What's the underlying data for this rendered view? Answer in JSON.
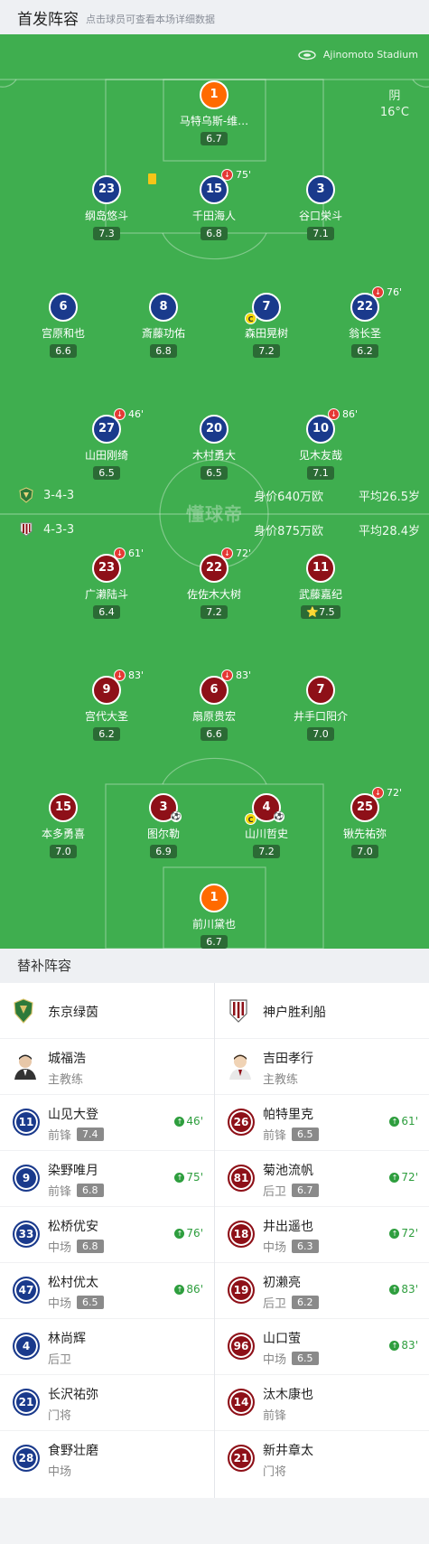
{
  "header": {
    "title": "首发阵容",
    "subtitle": "点击球员可查看本场详细数据"
  },
  "match": {
    "stadium": "Ajinomoto Stadium",
    "weather": "阴",
    "temperature": "16°C",
    "watermark": "懂球帝"
  },
  "colors": {
    "home": "#1a3a8c",
    "away": "#8e1018",
    "goalkeeper": "#ff6a00",
    "pitch": "#3fae4f"
  },
  "home_team": {
    "formation": "3-4-3",
    "value": "身价640万欧",
    "avg_age": "平均26.5岁"
  },
  "away_team": {
    "formation": "4-3-3",
    "value": "身价875万欧",
    "avg_age": "平均28.4岁"
  },
  "home_players": [
    {
      "number": "1",
      "name": "马特乌斯-维…",
      "rating": "6.7"
    },
    {
      "number": "23",
      "name": "纲岛悠斗",
      "rating": "7.3",
      "yellow_card": true
    },
    {
      "number": "15",
      "name": "千田海人",
      "rating": "6.8",
      "sub_minute": "75'"
    },
    {
      "number": "3",
      "name": "谷口栄斗",
      "rating": "7.1"
    },
    {
      "number": "6",
      "name": "宫原和也",
      "rating": "6.6"
    },
    {
      "number": "8",
      "name": "斎藤功佑",
      "rating": "6.8"
    },
    {
      "number": "7",
      "name": "森田晃树",
      "rating": "7.2",
      "captain": true
    },
    {
      "number": "22",
      "name": "翁长圣",
      "rating": "6.2",
      "sub_minute": "76'"
    },
    {
      "number": "27",
      "name": "山田刚绮",
      "rating": "6.5",
      "sub_minute": "46'"
    },
    {
      "number": "20",
      "name": "木村勇大",
      "rating": "6.5"
    },
    {
      "number": "10",
      "name": "见木友哉",
      "rating": "7.1",
      "sub_minute": "86'"
    }
  ],
  "away_players": [
    {
      "number": "23",
      "name": "广濑陆斗",
      "rating": "6.4",
      "sub_minute": "61'"
    },
    {
      "number": "22",
      "name": "佐佐木大树",
      "rating": "7.2",
      "sub_minute": "72'"
    },
    {
      "number": "11",
      "name": "武藤嘉纪",
      "rating": "7.5",
      "star": "⭐"
    },
    {
      "number": "9",
      "name": "宫代大圣",
      "rating": "6.2",
      "sub_minute": "83'"
    },
    {
      "number": "6",
      "name": "扇原贵宏",
      "rating": "6.6",
      "sub_minute": "83'"
    },
    {
      "number": "7",
      "name": "井手口阳介",
      "rating": "7.0"
    },
    {
      "number": "15",
      "name": "本多勇喜",
      "rating": "7.0"
    },
    {
      "number": "3",
      "name": "图尔勒",
      "rating": "6.9",
      "goal_icon": "pink-ball-icon"
    },
    {
      "number": "4",
      "name": "山川哲史",
      "rating": "7.2",
      "captain": true,
      "goal_icon": "ball-icon"
    },
    {
      "number": "25",
      "name": "锹先祐弥",
      "rating": "7.0",
      "sub_minute": "72'"
    },
    {
      "number": "1",
      "name": "前川黛也",
      "rating": "6.7"
    }
  ],
  "subs_section": {
    "title": "替补阵容"
  },
  "subs": {
    "home_team_name": "东京绿茵",
    "away_team_name": "神户胜利船",
    "home_coach": {
      "name": "城福浩",
      "role": "主教练"
    },
    "away_coach": {
      "name": "吉田孝行",
      "role": "主教练"
    },
    "home": [
      {
        "number": "11",
        "name": "山见大登",
        "position": "前锋",
        "rating": "7.4",
        "minute": "46'"
      },
      {
        "number": "9",
        "name": "染野唯月",
        "position": "前锋",
        "rating": "6.8",
        "minute": "75'"
      },
      {
        "number": "33",
        "name": "松桥优安",
        "position": "中场",
        "rating": "6.8",
        "minute": "76'"
      },
      {
        "number": "47",
        "name": "松村优太",
        "position": "中场",
        "rating": "6.5",
        "minute": "86'"
      },
      {
        "number": "4",
        "name": "林尚辉",
        "position": "后卫"
      },
      {
        "number": "21",
        "name": "长沢祐弥",
        "position": "门将"
      },
      {
        "number": "28",
        "name": "食野壮磨",
        "position": "中场"
      }
    ],
    "away": [
      {
        "number": "26",
        "name": "帕特里克",
        "position": "前锋",
        "rating": "6.5",
        "minute": "61'"
      },
      {
        "number": "81",
        "name": "菊池流帆",
        "position": "后卫",
        "rating": "6.7",
        "minute": "72'"
      },
      {
        "number": "18",
        "name": "井出遥也",
        "position": "中场",
        "rating": "6.3",
        "minute": "72'"
      },
      {
        "number": "19",
        "name": "初濑亮",
        "position": "后卫",
        "rating": "6.2",
        "minute": "83'"
      },
      {
        "number": "96",
        "name": "山口萤",
        "position": "中场",
        "rating": "6.5",
        "minute": "83'"
      },
      {
        "number": "14",
        "name": "汰木康也",
        "position": "前锋"
      },
      {
        "number": "21",
        "name": "新井章太",
        "position": "门将"
      }
    ]
  }
}
